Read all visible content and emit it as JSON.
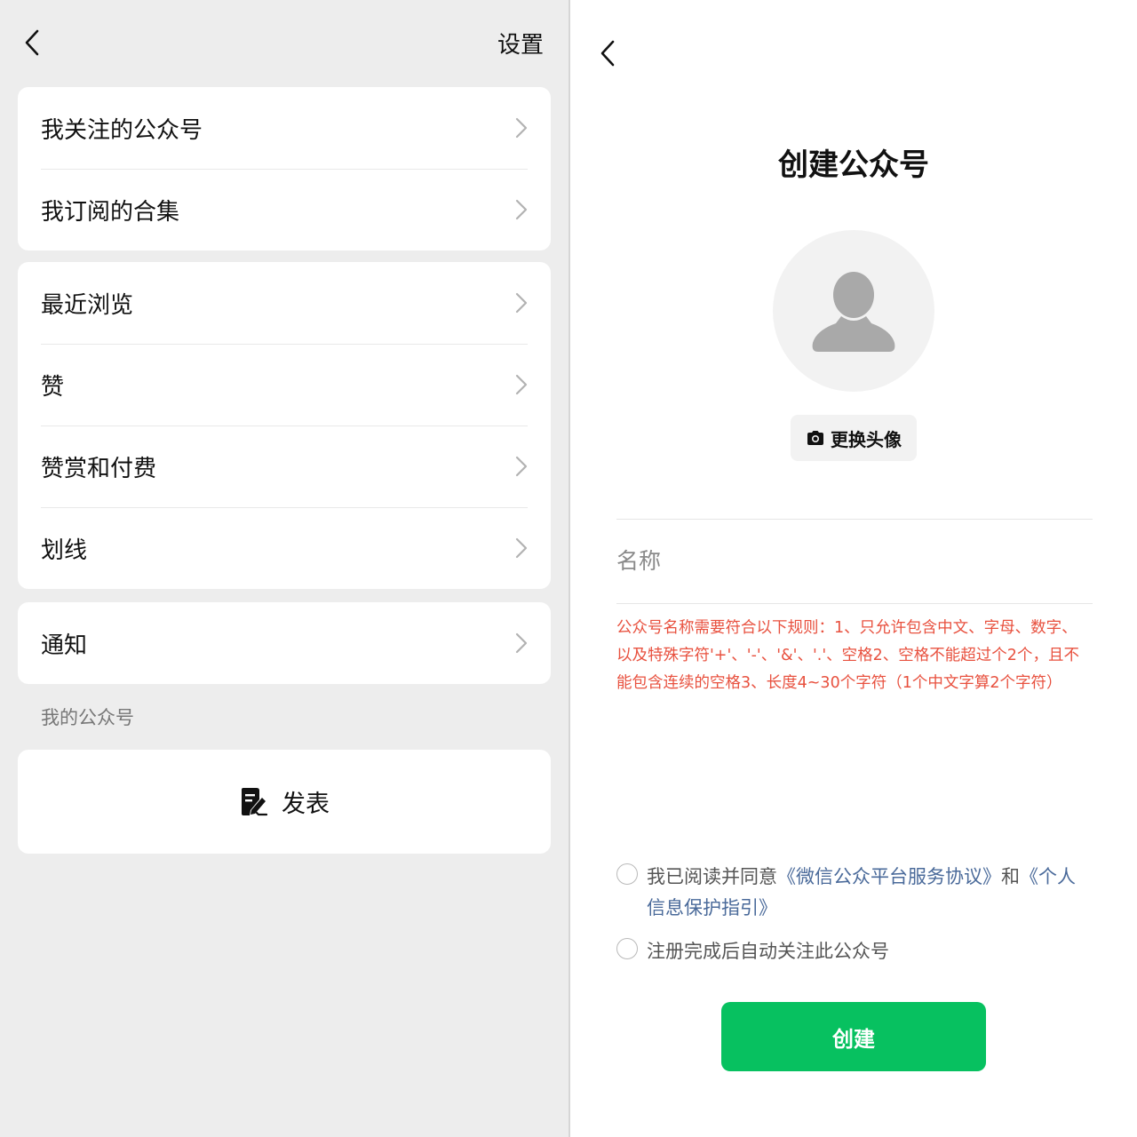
{
  "left": {
    "settings_label": "设置",
    "card1": [
      "我关注的公众号",
      "我订阅的合集"
    ],
    "card2": [
      "最近浏览",
      "赞",
      "赞赏和付费",
      "划线"
    ],
    "card3": [
      "通知"
    ],
    "section_label": "我的公众号",
    "publish_label": "发表"
  },
  "right": {
    "title": "创建公众号",
    "change_avatar_label": "更换头像",
    "name_placeholder": "名称",
    "rules_text": "公众号名称需要符合以下规则：1、只允许包含中文、字母、数字、以及特殊字符'+'、'-'、'&'、'.'、空格2、空格不能超过个2个，且不能包含连续的空格3、长度4~30个字符（1个中文字算2个字符）",
    "agree_prefix": "我已阅读并同意",
    "agree_link1": "《微信公众平台服务协议》",
    "agree_middle": "和",
    "agree_link2": "《个人信息保护指引》",
    "auto_follow_text": "注册完成后自动关注此公众号",
    "create_button_label": "创建"
  },
  "colors": {
    "accent_green": "#07c160",
    "warning_red": "#e8513f",
    "link_blue": "#4a6a9a"
  },
  "icons": {
    "back": "chevron-left-icon",
    "row_arrow": "chevron-right-icon",
    "publish": "edit-note-icon",
    "camera": "camera-icon",
    "avatar": "user-silhouette-icon"
  }
}
